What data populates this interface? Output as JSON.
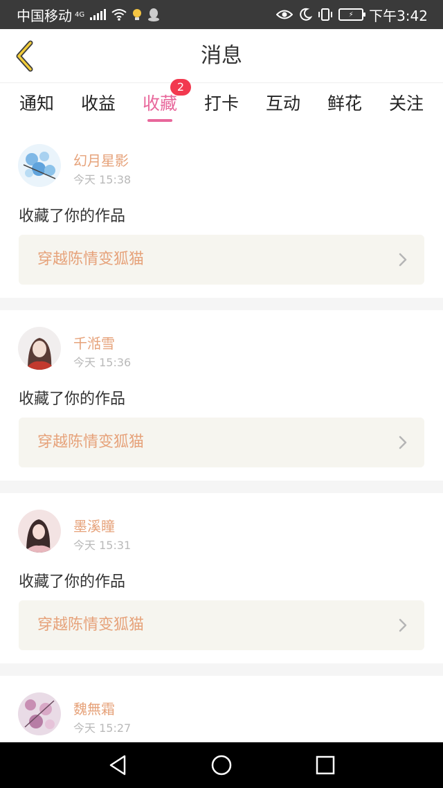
{
  "status_bar": {
    "carrier": "中国移动",
    "network": "4G",
    "time": "下午3:42"
  },
  "header": {
    "title": "消息",
    "back_icon": "chevron-left-icon"
  },
  "tabs": [
    {
      "label": "通知",
      "active": false
    },
    {
      "label": "收益",
      "active": false
    },
    {
      "label": "收藏",
      "active": true,
      "badge": "2"
    },
    {
      "label": "打卡",
      "active": false
    },
    {
      "label": "互动",
      "active": false
    },
    {
      "label": "鲜花",
      "active": false
    },
    {
      "label": "关注",
      "active": false
    }
  ],
  "messages": [
    {
      "name": "幻月星影",
      "time": "今天 15:38",
      "action": "收藏了你的作品",
      "work": "穿越陈情变狐猫"
    },
    {
      "name": "千湉雪",
      "time": "今天 15:36",
      "action": "收藏了你的作品",
      "work": "穿越陈情变狐猫"
    },
    {
      "name": "墨溪瞳",
      "time": "今天 15:31",
      "action": "收藏了你的作品",
      "work": "穿越陈情变狐猫"
    },
    {
      "name": "魏無霜",
      "time": "今天 15:27"
    }
  ],
  "colors": {
    "accent": "#e8679b",
    "badge": "#f2394f",
    "name": "#e6a27a",
    "card_bg": "#f6f5ef"
  }
}
